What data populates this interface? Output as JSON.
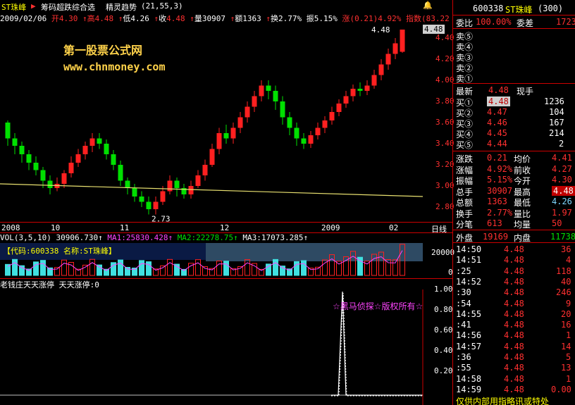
{
  "header": {
    "stock_name": "ST珠峰",
    "marker": "▶",
    "formula": "筹码超跌综合选",
    "indicator": "精灵趋势",
    "indicator_params": "(21,55,3)",
    "bell": "🔔"
  },
  "info": {
    "date": "2009/02/06",
    "open_label": "开",
    "open": "4.30",
    "high_label": "高",
    "high": "4.48",
    "low_label": "低",
    "low": "4.26",
    "close_label": "收",
    "close": "4.48",
    "volume_label": "量",
    "volume": "30907",
    "amount_label": "额",
    "amount": "1363",
    "turnover_label": "换",
    "turnover": "2.77%",
    "amplitude_label": "振",
    "amplitude": "5.15%",
    "change_label": "涨",
    "change": "(0.21)",
    "change_pct": "4.92%",
    "index_label": "指数",
    "index_val": "(83.22"
  },
  "watermark": {
    "line1": "第一股票公式网",
    "line2": "www.chnmoney.com"
  },
  "price_labels": {
    "high_mark": "4.48",
    "low_mark": "2.73"
  },
  "y_ticks": [
    "4.48",
    "4.40",
    "4.20",
    "4.00",
    "3.80",
    "3.60",
    "3.40",
    "3.20",
    "3.00",
    "2.80"
  ],
  "x_ticks": [
    {
      "label": "2008"
    },
    {
      "label": "10"
    },
    {
      "label": "11"
    },
    {
      "label": "12"
    },
    {
      "label": "2009"
    },
    {
      "label": "02"
    }
  ],
  "x_period": "日线",
  "volume": {
    "title": "VOL(3,5,10)",
    "value": "30906.730",
    "ma1_label": "MA1:25830.428",
    "ma2_label": "MA2:22278.75",
    "ma3_label": "MA3:17073.285",
    "box_code": "【代码:600338 名称:ST珠峰】",
    "y_ticks": [
      "20000",
      "0"
    ]
  },
  "indicator_panel": {
    "title": "老钱庄天天涨停",
    "sub": "天天涨停:0",
    "watermark": "☆黑马侦探☆版权所有☆",
    "y_ticks": [
      "1.00",
      "0.80",
      "0.60",
      "0.40",
      "0.20"
    ]
  },
  "panel": {
    "code": "600338",
    "name": "ST珠峰",
    "name_code": "(300)",
    "weibi_label": "委比",
    "weibi": "100.00%",
    "weicha_label": "委差",
    "weicha": "1723",
    "asks": [
      {
        "label": "卖⑤"
      },
      {
        "label": "卖④"
      },
      {
        "label": "卖③"
      },
      {
        "label": "卖②"
      },
      {
        "label": "卖①"
      }
    ],
    "latest_label": "最新",
    "latest": "4.48",
    "now_hand_label": "现手",
    "bids": [
      {
        "label": "买①",
        "price": "4.48",
        "vol": "1236"
      },
      {
        "label": "买②",
        "price": "4.47",
        "vol": "104"
      },
      {
        "label": "买③",
        "price": "4.46",
        "vol": "167"
      },
      {
        "label": "买④",
        "price": "4.45",
        "vol": "214"
      },
      {
        "label": "买⑤",
        "price": "4.44",
        "vol": "2"
      }
    ],
    "stats": [
      {
        "l1": "涨跌",
        "v1": "0.21",
        "l2": "均价",
        "v2": "4.41"
      },
      {
        "l1": "涨幅",
        "v1": "4.92%",
        "l2": "前收",
        "v2": "4.27"
      },
      {
        "l1": "振幅",
        "v1": "5.15%",
        "l2": "今开",
        "v2": "4.30"
      },
      {
        "l1": "总手",
        "v1": "30907",
        "l2": "最高",
        "v2": "4.48"
      },
      {
        "l1": "总额",
        "v1": "1363",
        "l2": "最低",
        "v2": "4.26"
      },
      {
        "l1": "换手",
        "v1": "2.77%",
        "l2": "量比",
        "v2": "1.97"
      },
      {
        "l1": "分笔",
        "v1": "613",
        "l2": "均量",
        "v2": "50"
      }
    ],
    "outer_label": "外盘",
    "outer": "19169",
    "inner_label": "内盘",
    "inner": "11738",
    "ticks": [
      {
        "t": "14:50",
        "p": "4.48",
        "v": "36"
      },
      {
        "t": "14:51",
        "p": "4.48",
        "v": "4"
      },
      {
        "t": ":25",
        "p": "4.48",
        "v": "118"
      },
      {
        "t": "14:52",
        "p": "4.48",
        "v": "40"
      },
      {
        "t": ":30",
        "p": "4.48",
        "v": "246"
      },
      {
        "t": ":54",
        "p": "4.48",
        "v": "9"
      },
      {
        "t": "14:55",
        "p": "4.48",
        "v": "20"
      },
      {
        "t": ":41",
        "p": "4.48",
        "v": "16"
      },
      {
        "t": "14:56",
        "p": "4.48",
        "v": "1"
      },
      {
        "t": "14:57",
        "p": "4.48",
        "v": "14"
      },
      {
        "t": ":36",
        "p": "4.48",
        "v": "5"
      },
      {
        "t": ":55",
        "p": "4.48",
        "v": "13"
      },
      {
        "t": "14:58",
        "p": "4.48",
        "v": "1"
      },
      {
        "t": "14:59",
        "p": "4.48",
        "v": "0.00"
      }
    ],
    "footer": "仅供内部用指略讯或特处"
  },
  "chart_data": {
    "type": "candlestick",
    "ylim": [
      2.7,
      4.5
    ],
    "candles": [
      [
        3.6,
        3.45,
        3.62,
        3.38
      ],
      [
        3.45,
        3.38,
        3.5,
        3.3
      ],
      [
        3.38,
        3.3,
        3.42,
        3.22
      ],
      [
        3.3,
        3.22,
        3.34,
        3.15
      ],
      [
        3.22,
        3.15,
        3.28,
        3.1
      ],
      [
        3.15,
        3.05,
        3.18,
        2.98
      ],
      [
        3.05,
        2.98,
        3.1,
        2.92
      ],
      [
        2.98,
        3.02,
        3.08,
        2.95
      ],
      [
        3.02,
        3.12,
        3.15,
        2.98
      ],
      [
        3.12,
        3.22,
        3.28,
        3.08
      ],
      [
        3.22,
        3.3,
        3.35,
        3.18
      ],
      [
        3.3,
        3.38,
        3.42,
        3.25
      ],
      [
        3.38,
        3.45,
        3.5,
        3.32
      ],
      [
        3.45,
        3.4,
        3.5,
        3.35
      ],
      [
        3.4,
        3.3,
        3.44,
        3.25
      ],
      [
        3.3,
        3.2,
        3.34,
        3.15
      ],
      [
        3.2,
        3.05,
        3.24,
        3.0
      ],
      [
        3.05,
        2.98,
        3.08,
        2.92
      ],
      [
        2.98,
        2.9,
        3.02,
        2.85
      ],
      [
        2.9,
        2.85,
        2.95,
        2.8
      ],
      [
        2.85,
        2.78,
        2.9,
        2.73
      ],
      [
        2.78,
        2.85,
        2.9,
        2.73
      ],
      [
        2.85,
        2.95,
        3.0,
        2.82
      ],
      [
        2.95,
        3.05,
        3.1,
        2.92
      ],
      [
        3.05,
        2.98,
        3.08,
        2.9
      ],
      [
        2.98,
        2.92,
        3.02,
        2.88
      ],
      [
        2.92,
        3.0,
        3.05,
        2.88
      ],
      [
        3.0,
        3.1,
        3.15,
        2.98
      ],
      [
        3.1,
        3.2,
        3.25,
        3.05
      ],
      [
        3.2,
        3.35,
        3.4,
        3.18
      ],
      [
        3.35,
        3.5,
        3.55,
        3.3
      ],
      [
        3.5,
        3.45,
        3.58,
        3.4
      ],
      [
        3.45,
        3.55,
        3.6,
        3.4
      ],
      [
        3.55,
        3.65,
        3.7,
        3.5
      ],
      [
        3.65,
        3.75,
        3.8,
        3.6
      ],
      [
        3.75,
        3.85,
        3.9,
        3.7
      ],
      [
        3.85,
        3.95,
        4.0,
        3.8
      ],
      [
        3.95,
        3.9,
        4.0,
        3.82
      ],
      [
        3.9,
        3.8,
        3.95,
        3.72
      ],
      [
        3.8,
        3.65,
        3.85,
        3.58
      ],
      [
        3.65,
        3.55,
        3.7,
        3.48
      ],
      [
        3.55,
        3.45,
        3.6,
        3.38
      ],
      [
        3.45,
        3.4,
        3.5,
        3.35
      ],
      [
        3.4,
        3.48,
        3.52,
        3.36
      ],
      [
        3.48,
        3.55,
        3.6,
        3.44
      ],
      [
        3.55,
        3.62,
        3.66,
        3.5
      ],
      [
        3.62,
        3.7,
        3.75,
        3.58
      ],
      [
        3.7,
        3.78,
        3.82,
        3.66
      ],
      [
        3.78,
        3.85,
        3.9,
        3.74
      ],
      [
        3.85,
        3.92,
        3.96,
        3.8
      ],
      [
        3.92,
        3.9,
        3.98,
        3.85
      ],
      [
        3.9,
        3.95,
        4.0,
        3.86
      ],
      [
        3.95,
        4.05,
        4.1,
        3.92
      ],
      [
        4.05,
        4.15,
        4.2,
        4.0
      ],
      [
        4.15,
        4.25,
        4.3,
        4.1
      ],
      [
        4.25,
        4.35,
        4.4,
        4.2
      ],
      [
        4.27,
        4.48,
        4.48,
        4.26
      ]
    ],
    "ma_line": {
      "start": 3.02,
      "end": 2.9
    }
  }
}
